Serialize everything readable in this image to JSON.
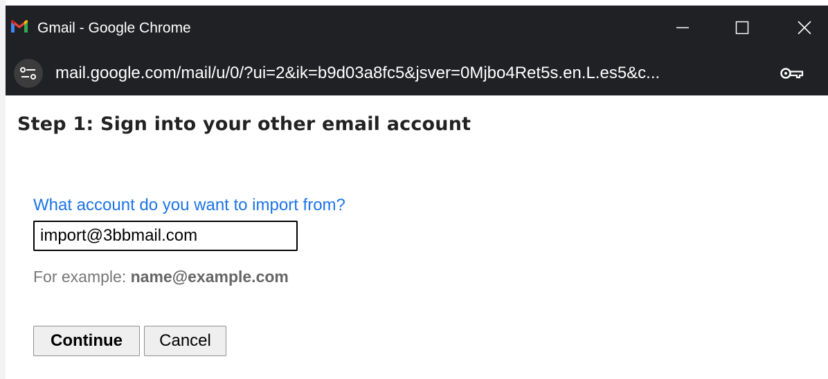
{
  "window": {
    "title": "Gmail - Google Chrome"
  },
  "addressbar": {
    "url": "mail.google.com/mail/u/0/?ui=2&ik=b9d03a8fc5&jsver=0Mjbo4Ret5s.en.L.es5&c..."
  },
  "dialog": {
    "heading": "Step 1: Sign into your other email account",
    "question": "What account do you want to import from?",
    "email_value": "import@3bbmail.com",
    "example_prefix": "For example: ",
    "example_email": "name@example.com",
    "continue_label": "Continue",
    "cancel_label": "Cancel"
  },
  "colors": {
    "titlebar_bg": "#202124",
    "question_blue": "#1a73e8",
    "example_gray": "#777777"
  },
  "icons": {
    "app": "gmail-logo-icon",
    "site_info": "site-settings-icon",
    "password": "key-icon"
  }
}
